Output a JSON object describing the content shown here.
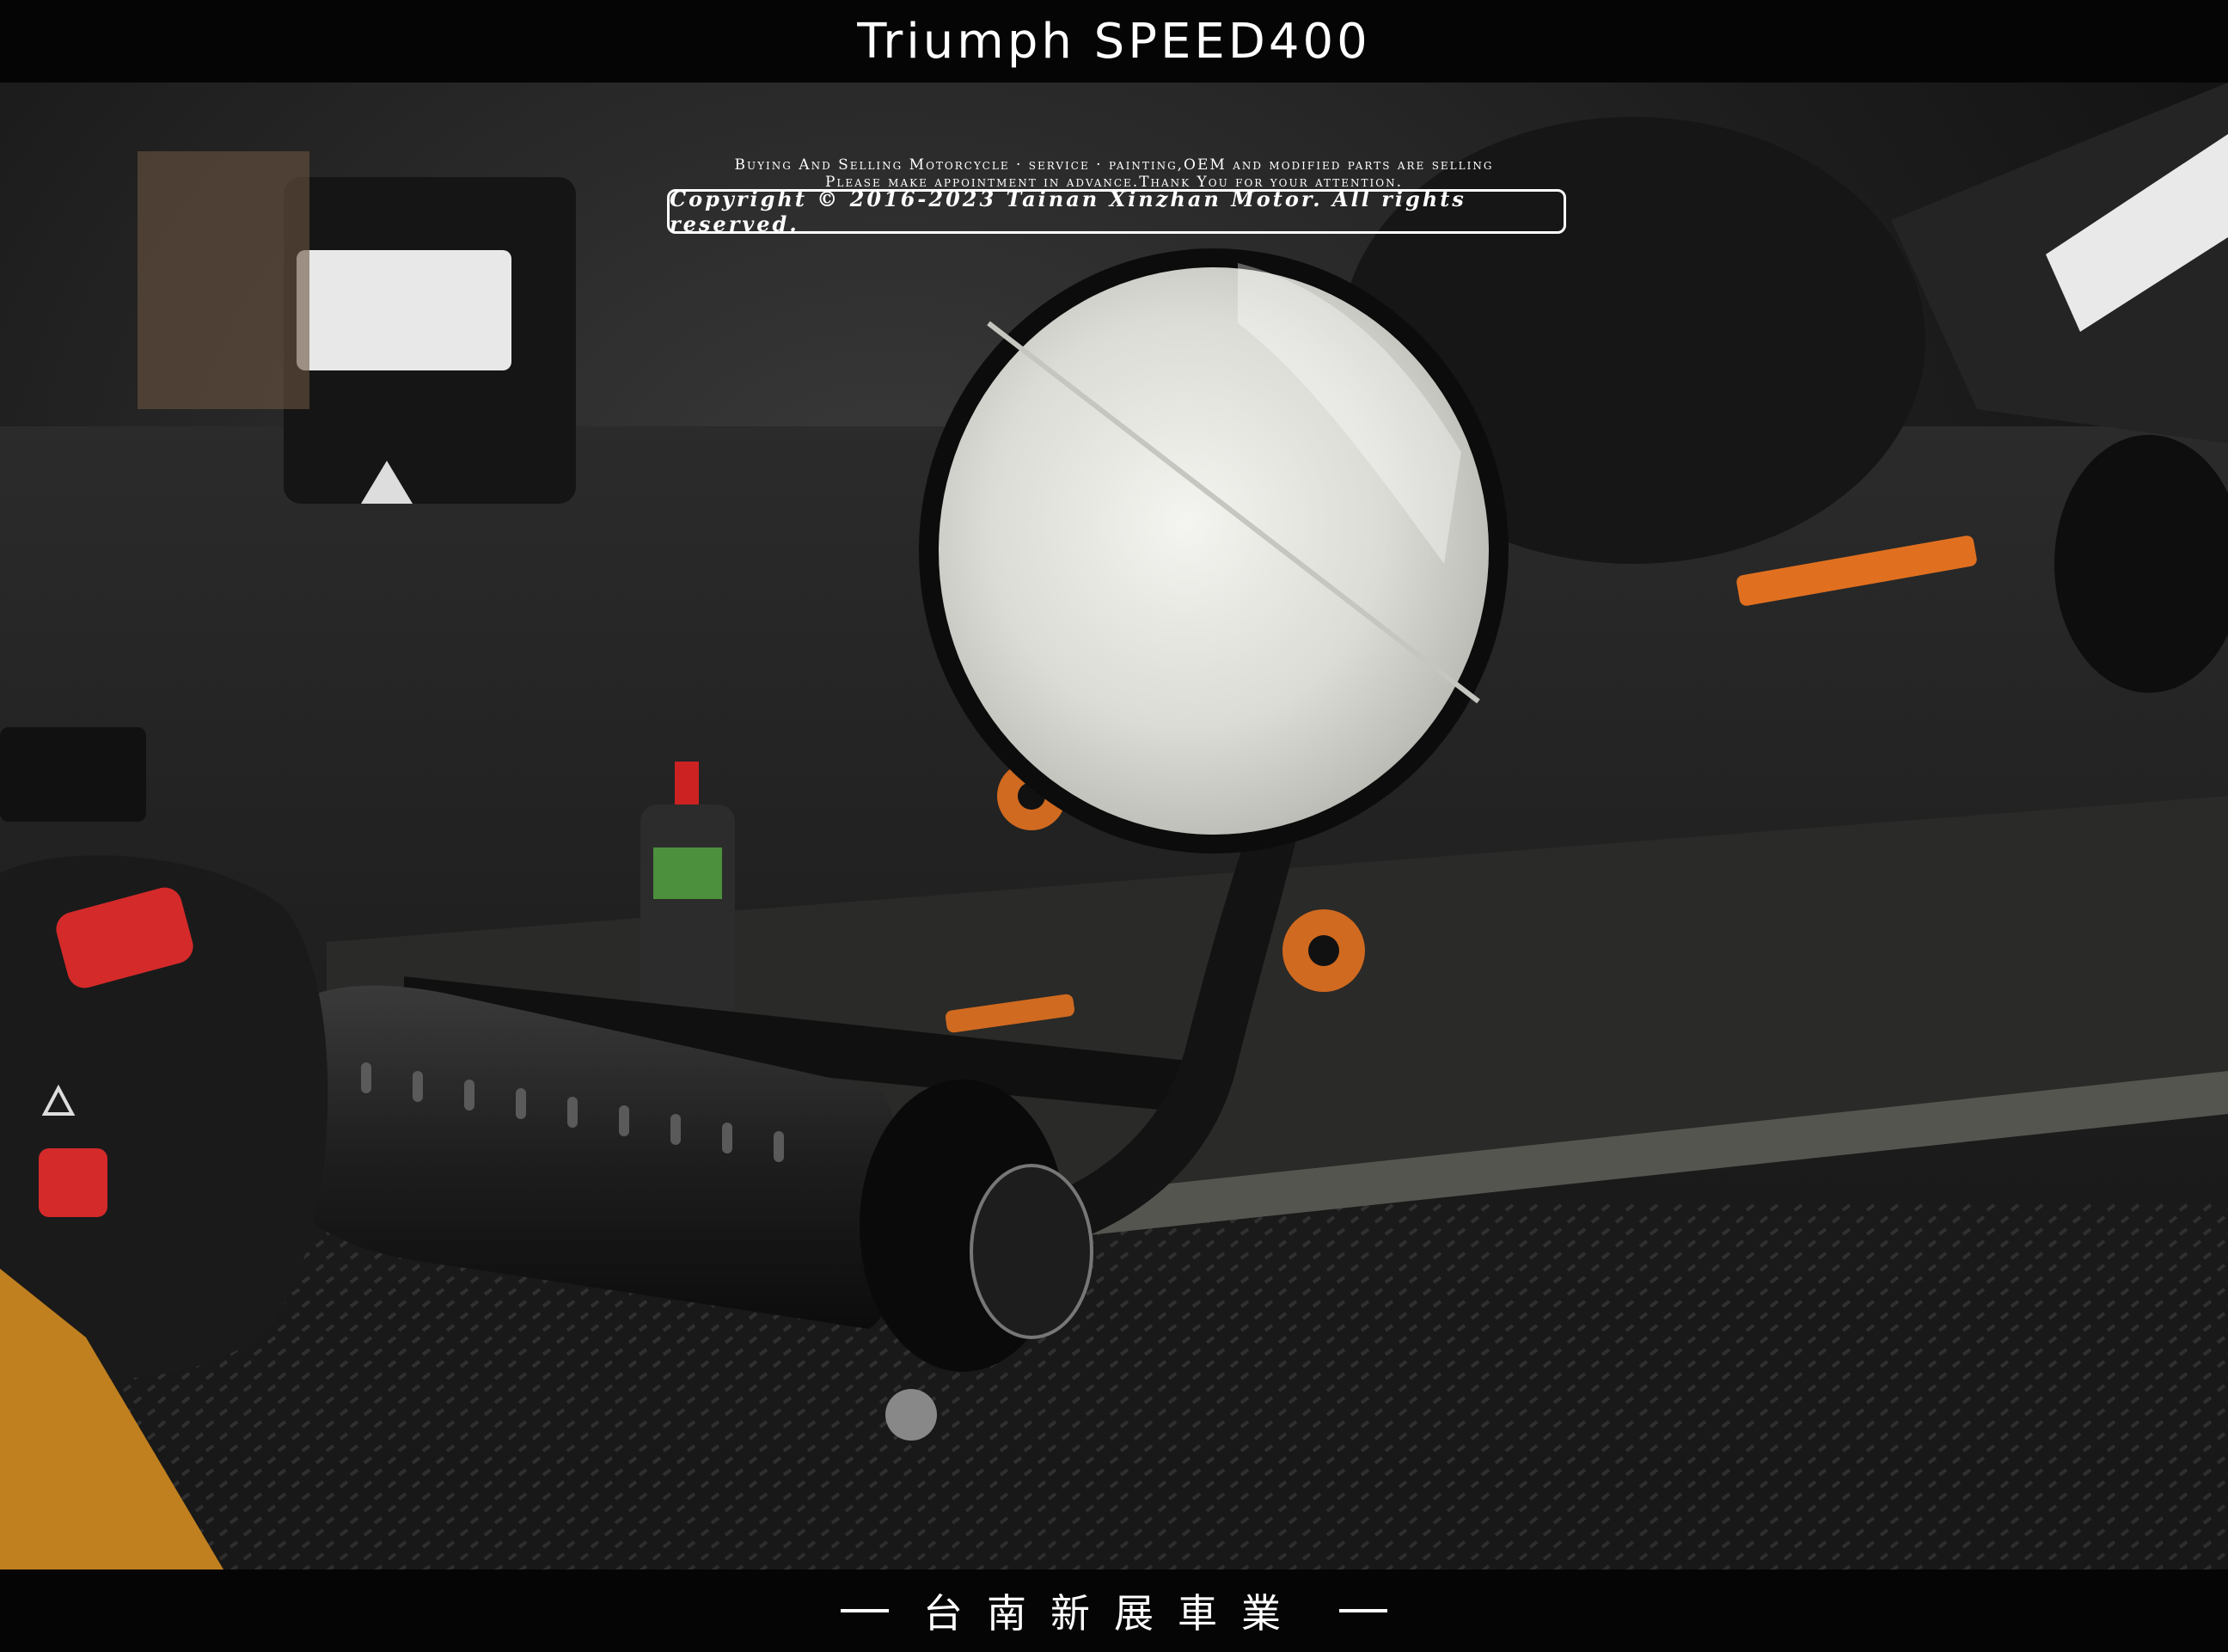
{
  "header": {
    "title": "Triumph SPEED400"
  },
  "watermark": {
    "copyright": "Copyright © 2016-2023 Tainan Xinzhan Motor. All rights reserved.",
    "line1": "Buying And Selling Motorcycle · service · painting,OEM and modified parts are selling",
    "line2": "Please make appointment in advance.Thank You for your attention."
  },
  "footer": {
    "title": "台南新展車業"
  },
  "colors": {
    "bar_bg": "#050505",
    "switch_red": "#d42a2a",
    "orange_parts": "#e07020"
  }
}
